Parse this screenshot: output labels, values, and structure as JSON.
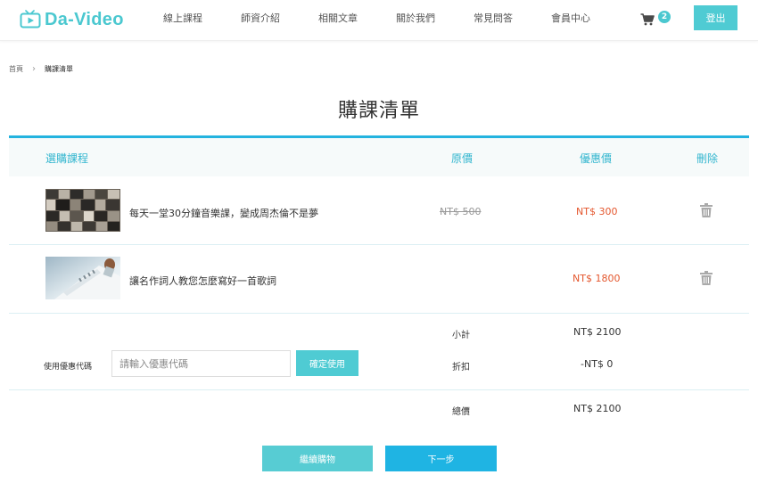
{
  "header": {
    "logo_text": "Da-Video",
    "nav": [
      "線上課程",
      "師資介紹",
      "相關文章",
      "關於我們",
      "常見問答",
      "會員中心"
    ],
    "cart_count": "2",
    "logout_label": "登出"
  },
  "breadcrumb": {
    "home": "首頁",
    "current": "購課清單"
  },
  "page_title": "購課清單",
  "table": {
    "headers": {
      "course": "選購課程",
      "original_price": "原價",
      "sale_price": "優惠價",
      "delete": "刪除"
    },
    "rows": [
      {
        "name": "每天一堂30分鐘音樂課，變成周杰倫不是夢",
        "original_price": "NT$ 500",
        "sale_price": "NT$ 300",
        "thumbnail": "tv-wall-image"
      },
      {
        "name": "讓名作詞人教您怎麼寫好一首歌詞",
        "original_price": "",
        "sale_price": "NT$ 1800",
        "thumbnail": "legal-paper-image"
      }
    ]
  },
  "summary": {
    "coupon_label": "使用優惠代碼",
    "coupon_placeholder": "請輸入優惠代碼",
    "coupon_button": "確定使用",
    "subtotal_label": "小計",
    "subtotal_value": "NT$ 2100",
    "discount_label": "折扣",
    "discount_value": "-NT$ 0",
    "total_label": "總價",
    "total_value": "NT$ 2100"
  },
  "actions": {
    "continue_label": "繼續購物",
    "next_label": "下一步"
  },
  "colors": {
    "accent": "#4bc8d0",
    "primary_blue": "#1fb4e3",
    "sale_red": "#e4572e"
  }
}
